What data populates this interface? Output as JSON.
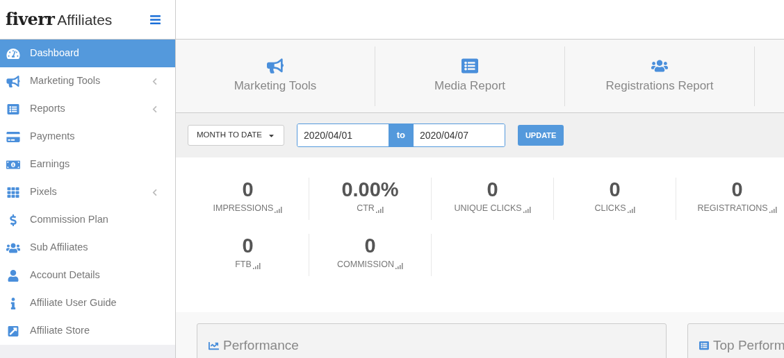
{
  "brand": {
    "logo": "fiverr",
    "name": "Affiliates"
  },
  "sidebar": {
    "items": [
      {
        "label": "Dashboard",
        "selected": true,
        "expandable": false
      },
      {
        "label": "Marketing Tools",
        "selected": false,
        "expandable": true
      },
      {
        "label": "Reports",
        "selected": false,
        "expandable": true
      },
      {
        "label": "Payments",
        "selected": false,
        "expandable": false
      },
      {
        "label": "Earnings",
        "selected": false,
        "expandable": false
      },
      {
        "label": "Pixels",
        "selected": false,
        "expandable": true
      },
      {
        "label": "Commission Plan",
        "selected": false,
        "expandable": false
      },
      {
        "label": "Sub Affiliates",
        "selected": false,
        "expandable": false
      },
      {
        "label": "Account Details",
        "selected": false,
        "expandable": false
      },
      {
        "label": "Affiliate User Guide",
        "selected": false,
        "expandable": false
      },
      {
        "label": "Affiliate Store",
        "selected": false,
        "expandable": false
      }
    ]
  },
  "shortcuts": [
    {
      "label": "Marketing Tools"
    },
    {
      "label": "Media Report"
    },
    {
      "label": "Registrations Report"
    }
  ],
  "filter": {
    "period": "MONTH TO DATE",
    "from": "2020/04/01",
    "separator": "to",
    "to": "2020/04/07",
    "button": "UPDATE"
  },
  "stats": [
    {
      "value": "0",
      "label": "IMPRESSIONS"
    },
    {
      "value": "0.00%",
      "label": "CTR"
    },
    {
      "value": "0",
      "label": "UNIQUE CLICKS"
    },
    {
      "value": "0",
      "label": "CLICKS"
    },
    {
      "value": "0",
      "label": "REGISTRATIONS"
    },
    {
      "value": "0",
      "label": "FTB"
    },
    {
      "value": "0",
      "label": "COMMISSION"
    }
  ],
  "panels": [
    {
      "title": "Performance"
    },
    {
      "title": "Top Perform"
    }
  ]
}
